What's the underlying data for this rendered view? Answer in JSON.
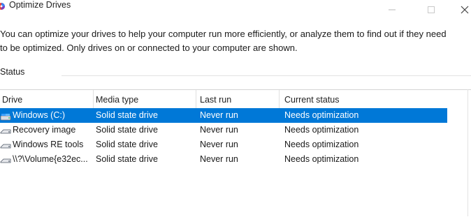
{
  "window": {
    "title": "Optimize Drives"
  },
  "description": {
    "line1": "You can optimize your drives to help your computer run more efficiently, or analyze them to find out if they need",
    "line2": "to be optimized. Only drives on or connected to your computer are shown."
  },
  "status": {
    "label": "Status"
  },
  "table": {
    "columns": [
      "Drive",
      "Media type",
      "Last run",
      "Current status"
    ],
    "rows": [
      {
        "drive": "Windows (C:)",
        "media_type": "Solid state drive",
        "last_run": "Never run",
        "status": "Needs optimization",
        "selected": true
      },
      {
        "drive": "Recovery image",
        "media_type": "Solid state drive",
        "last_run": "Never run",
        "status": "Needs optimization",
        "selected": false
      },
      {
        "drive": "Windows RE tools",
        "media_type": "Solid state drive",
        "last_run": "Never run",
        "status": "Needs optimization",
        "selected": false
      },
      {
        "drive": "\\\\?\\Volume{e32ec...",
        "media_type": "Solid state drive",
        "last_run": "Never run",
        "status": "Needs optimization",
        "selected": false
      }
    ]
  },
  "icons": {
    "app": "optimize-drives-icon",
    "minimize": "minimize-icon",
    "maximize": "maximize-icon",
    "close": "close-icon",
    "drive": "drive-icon"
  },
  "colors": {
    "selection": "#0078d7",
    "selection_text": "#ffffff"
  }
}
